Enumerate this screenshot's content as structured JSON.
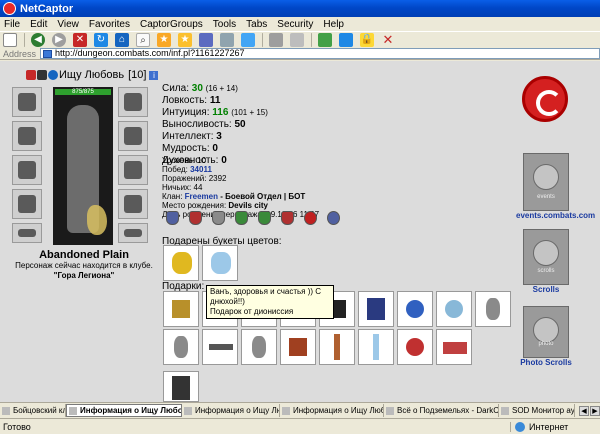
{
  "window": {
    "title": "NetCaptor"
  },
  "menu": [
    "File",
    "Edit",
    "View",
    "Favorites",
    "CaptorGroups",
    "Tools",
    "Tabs",
    "Security",
    "Help"
  ],
  "address": {
    "label": "Address",
    "url": "http://dungeon.combats.com/inf.pl?1161227267"
  },
  "character": {
    "name": "Ищу Любовь",
    "level": "[10]",
    "hp": "875/875"
  },
  "stats": {
    "strength": {
      "label": "Сила:",
      "value": "30",
      "mod": "(16 + 14)"
    },
    "agility": {
      "label": "Ловкость:",
      "value": "11"
    },
    "intuition": {
      "label": "Интуиция:",
      "value": "116",
      "mod": "(101 + 15)"
    },
    "endurance": {
      "label": "Выносливость:",
      "value": "50"
    },
    "intellect": {
      "label": "Интеллект:",
      "value": "3"
    },
    "wisdom": {
      "label": "Мудрость:",
      "value": "0"
    },
    "spirit": {
      "label": "Духовность:",
      "value": "0"
    }
  },
  "info": {
    "level": "Уровень: 10",
    "wins_label": "Побед:",
    "wins_value": "34011",
    "losses": "Поражений: 2392",
    "draws": "Ничьих: 44",
    "clan_label": "Клан:",
    "clan_name": "Freemen",
    "clan_dept": " - Боевой Отдел | БОТ",
    "birthplace_label": "Место рождения:",
    "birthplace": "Devils city",
    "birthday": "День рождения персонажа: 19.10.06 11:07"
  },
  "location": {
    "place": "Abandoned Plain",
    "note": "Персонаж сейчас находится в клубе.",
    "room": "\"Гора Легиона\""
  },
  "flowers_label": "Подарены букеты цветов:",
  "gifts_label": "Подарки:",
  "tooltip": {
    "line1": "Ванъ, здоровья и счастья )) С днюхой!!)",
    "line2": "Подарок от диониссия"
  },
  "banners": {
    "events": {
      "caption": "events.combats.com",
      "text": "events"
    },
    "scrolls": {
      "caption": "Scrolls",
      "text": "scrolls"
    },
    "photo": {
      "caption": "Photo Scrolls",
      "text": "photo"
    }
  },
  "tabs": [
    {
      "label": "Бойцовский клуб",
      "active": false
    },
    {
      "label": "Информация о Ищу Любовь",
      "active": true
    },
    {
      "label": "Информация о Ищу Любовь",
      "active": false
    },
    {
      "label": "Информация о Ищу Любовь",
      "active": false
    },
    {
      "label": "Всё о Подземельях - DarkClan.Ru",
      "active": false
    },
    {
      "label": "SOD Монитор аукцио",
      "active": false
    }
  ],
  "status": {
    "ready": "Готово",
    "zone": "Интернет"
  },
  "colors": {
    "titlebar": "#0047c8",
    "stat_highlight": "#008000",
    "link": "#1a3aa0",
    "logo": "#d42020"
  }
}
